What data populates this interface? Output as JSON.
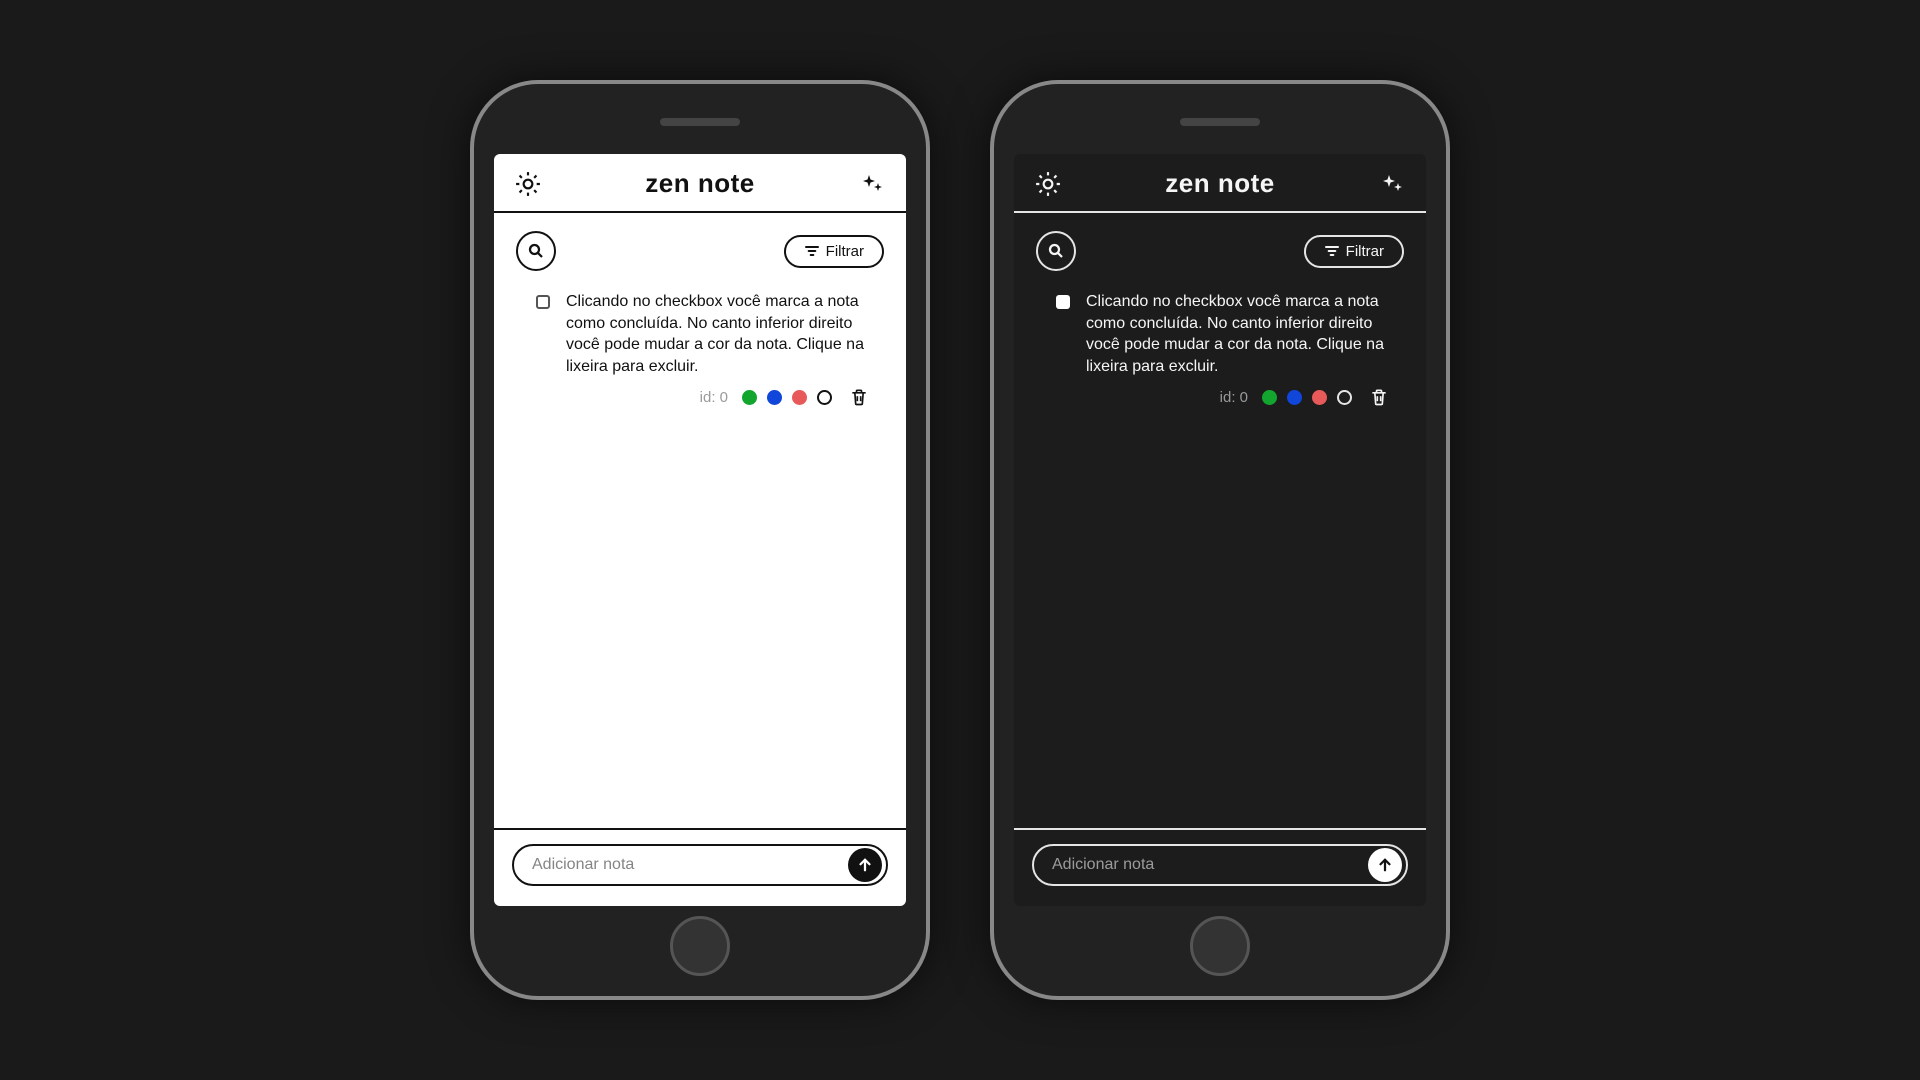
{
  "app": {
    "title": "zen note"
  },
  "toolbar": {
    "filter_label": "Filtrar"
  },
  "note": {
    "text": "Clicando no checkbox você marca a nota como concluída. No canto inferior direito você pode mudar a cor da nota. Clique na lixeira para excluir.",
    "id_label": "id: 0",
    "colors": [
      "green",
      "blue",
      "red",
      "outline"
    ]
  },
  "footer": {
    "placeholder": "Adicionar nota"
  },
  "themes": [
    "light",
    "dark"
  ]
}
